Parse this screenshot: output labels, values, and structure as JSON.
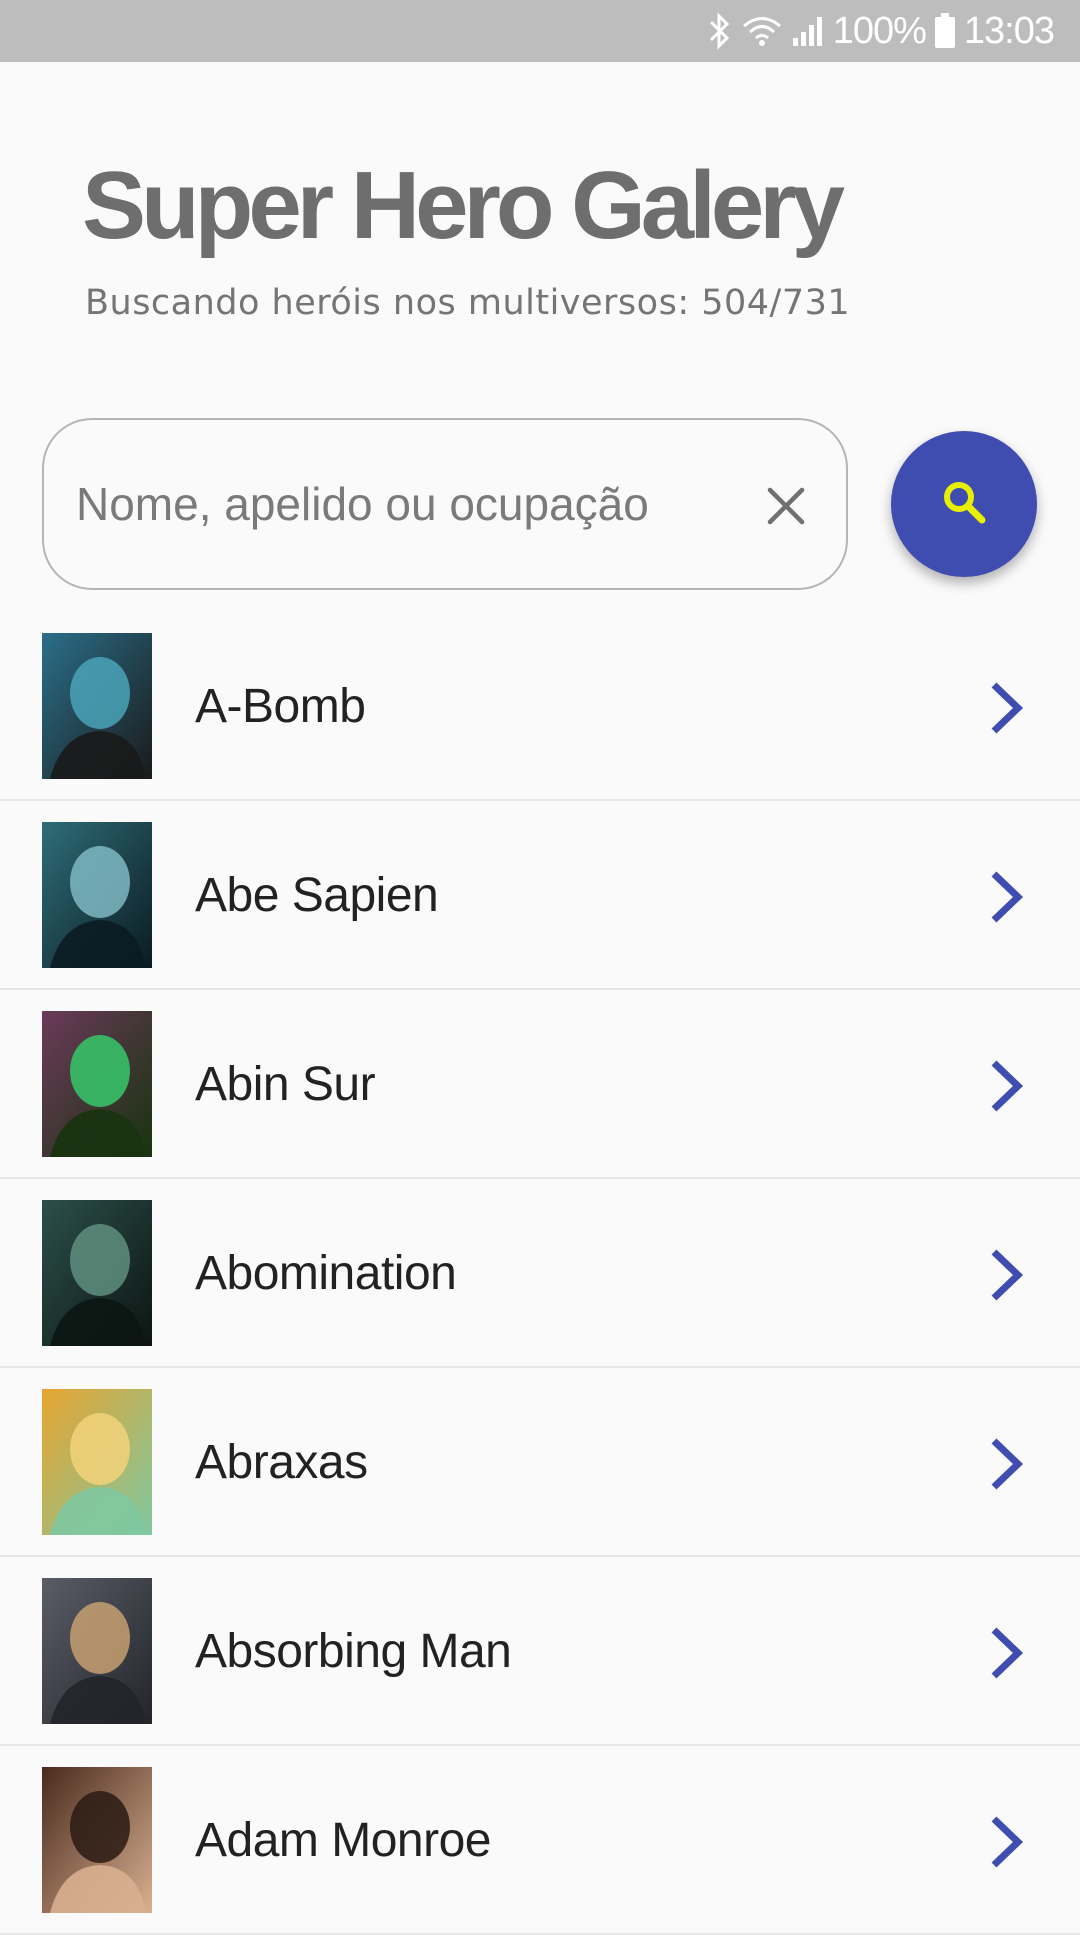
{
  "status_bar": {
    "battery": "100%",
    "time": "13:03",
    "icons": [
      "bluetooth-icon",
      "wifi-icon",
      "signal-icon",
      "battery-icon"
    ]
  },
  "header": {
    "title": "Super Hero Galery",
    "subtitle": "Buscando heróis nos multiversos: 504/731"
  },
  "search": {
    "placeholder": "Nome, apelido ou ocupação",
    "value": "",
    "clear_icon": "close-icon",
    "button_icon": "search-icon"
  },
  "colors": {
    "accent": "#3f4db0",
    "search_glyph": "#e8f000",
    "title": "#6e6e6e",
    "status_bar": "#bdbdbd"
  },
  "heroes": [
    {
      "name": "A-Bomb",
      "thumb_colors": [
        "#2b6f8a",
        "#1a1a1a",
        "#4aa3b8"
      ]
    },
    {
      "name": "Abe Sapien",
      "thumb_colors": [
        "#2f6d78",
        "#0b1b22",
        "#7fb9c2"
      ]
    },
    {
      "name": "Abin Sur",
      "thumb_colors": [
        "#6b3a5a",
        "#18330f",
        "#36c86a"
      ]
    },
    {
      "name": "Abomination",
      "thumb_colors": [
        "#2c4f4a",
        "#0c1512",
        "#5f8f7f"
      ]
    },
    {
      "name": "Abraxas",
      "thumb_colors": [
        "#e6a430",
        "#7fc8a0",
        "#f2d27a"
      ]
    },
    {
      "name": "Absorbing Man",
      "thumb_colors": [
        "#5a5d66",
        "#23252b",
        "#c5a070"
      ]
    },
    {
      "name": "Adam Monroe",
      "thumb_colors": [
        "#4a2a1e",
        "#d8b090",
        "#2a1a12"
      ]
    }
  ]
}
